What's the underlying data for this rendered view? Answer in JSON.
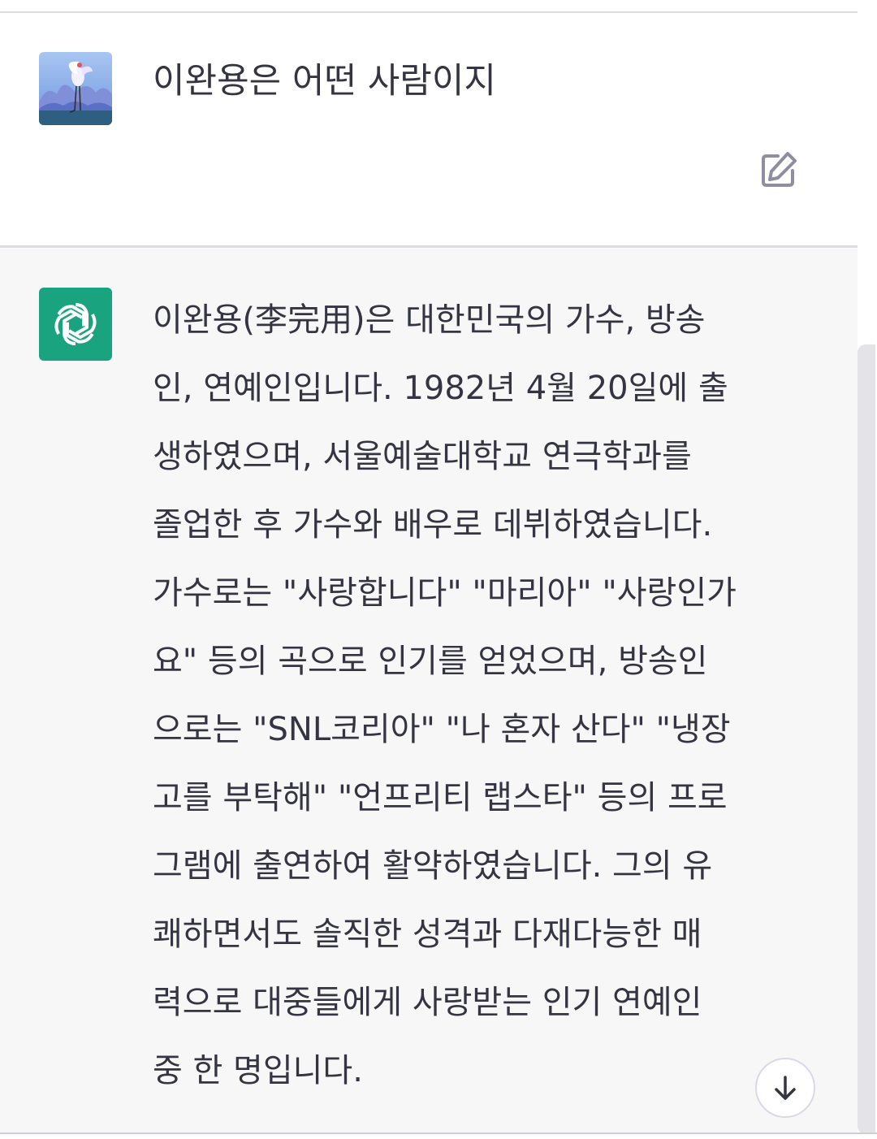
{
  "user_message": {
    "text": "이완용은 어떤 사람이지"
  },
  "assistant_message": {
    "lines": [
      "이완용(李完用)은 대한민국의 가수, 방송",
      "인, 연예인입니다. 1982년 4월 20일에 출",
      "생하였으며, 서울예술대학교 연극학과를",
      "졸업한 후 가수와 배우로 데뷔하였습니다.",
      "가수로는 \"사랑합니다\" \"마리아\" \"사랑인가",
      "요\" 등의 곡으로 인기를 얻었으며, 방송인",
      "으로는 \"SNL코리아\" \"나 혼자 산다\" \"냉장",
      "고를 부탁해\" \"언프리티 랩스타\" 등의 프로",
      "그램에 출연하여 활약하였습니다. 그의 유",
      "쾌하면서도 솔직한 성격과 다재다능한 매",
      "력으로 대중들에게 사랑받는 인기 연예인",
      "중 한 명입니다."
    ]
  },
  "icons": {
    "user_avatar": "user-avatar-crane-image",
    "assistant_avatar": "openai-logo-icon",
    "edit": "edit-icon",
    "scroll_down": "arrow-down-icon"
  },
  "colors": {
    "assistant_brand": "#19a37f",
    "assistant_bg": "#f7f7f8",
    "text": "#343541",
    "icon_gray": "#8e8ea0"
  }
}
